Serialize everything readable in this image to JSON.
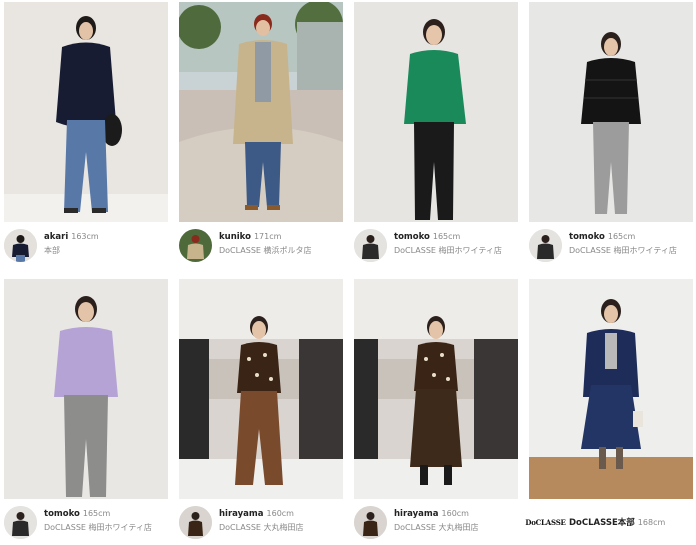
{
  "cards": [
    {
      "name": "akari",
      "height": "163cm",
      "store": "本部"
    },
    {
      "name": "kuniko",
      "height": "171cm",
      "store": "DoCLASSE 横浜ポルタ店"
    },
    {
      "name": "tomoko",
      "height": "165cm",
      "store": "DoCLASSE 梅田ホワイティ店"
    },
    {
      "name": "tomoko",
      "height": "165cm",
      "store": "DoCLASSE 梅田ホワイティ店"
    },
    {
      "name": "tomoko",
      "height": "165cm",
      "store": "DoCLASSE 梅田ホワイティ店"
    },
    {
      "name": "hirayama",
      "height": "160cm",
      "store": "DoCLASSE 大丸梅田店"
    },
    {
      "name": "hirayama",
      "height": "160cm",
      "store": "DoCLASSE 大丸梅田店"
    },
    {
      "name": "DoCLASSE本部",
      "height": "168cm",
      "store": "",
      "logo": "DoCLASSE"
    }
  ],
  "colors": {
    "name": "#222222",
    "meta": "#888888"
  }
}
